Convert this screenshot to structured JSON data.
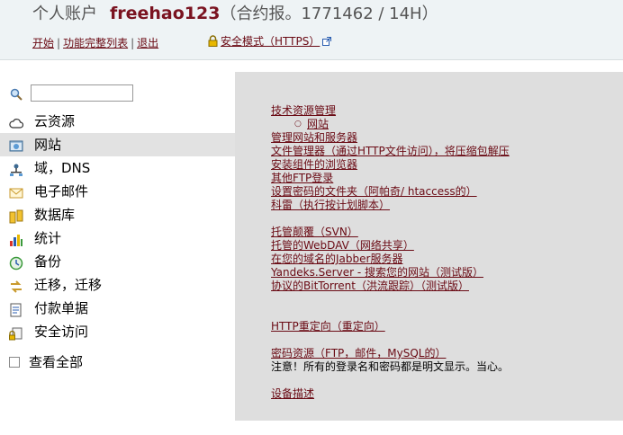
{
  "header": {
    "account_label": "个人账户",
    "username": "freehao123",
    "contract": "（合约报。1771462 / 14H）"
  },
  "topnav": {
    "start": "开始",
    "full_list": "功能完整列表",
    "logout": "退出",
    "secure_mode": "安全模式（HTTPS）"
  },
  "sidebar": {
    "items": [
      {
        "label": "云资源",
        "icon": "cloud-icon"
      },
      {
        "label": "网站",
        "icon": "website-icon"
      },
      {
        "label": "域，DNS",
        "icon": "domain-icon"
      },
      {
        "label": "电子邮件",
        "icon": "email-icon"
      },
      {
        "label": "数据库",
        "icon": "database-icon"
      },
      {
        "label": "统计",
        "icon": "stats-icon"
      },
      {
        "label": "备份",
        "icon": "backup-icon"
      },
      {
        "label": "迁移，迁移",
        "icon": "migrate-icon"
      },
      {
        "label": "付款单据",
        "icon": "invoice-icon"
      },
      {
        "label": "安全访问",
        "icon": "security-icon"
      }
    ],
    "view_all": "查看全部",
    "active_index": 1
  },
  "content": {
    "group1": [
      "技术资源管理",
      "网站",
      "管理网站和服务器",
      "文件管理器（通过HTTP文件访问），将压缩包解压",
      "安装组件的浏览器",
      "其他FTP登录",
      "设置密码的文件夹（阿帕奇/ htaccess的）",
      "科雷（执行按计划脚本）"
    ],
    "group2": [
      "托管颠覆（SVN）",
      "托管的WebDAV（网络共享）",
      "在您的域名的Jabber服务器",
      "Yandeks.Server - 搜索您的网站（测试版）",
      "协议的BitTorrent（洪流跟踪）（测试版）"
    ],
    "redirect": "HTTP重定向（重定向）",
    "passwords": "密码资源（FTP，邮件，MySQL的）",
    "note": "注意！所有的登录名和密码都是明文显示。当心。",
    "devices": "设备描述"
  }
}
